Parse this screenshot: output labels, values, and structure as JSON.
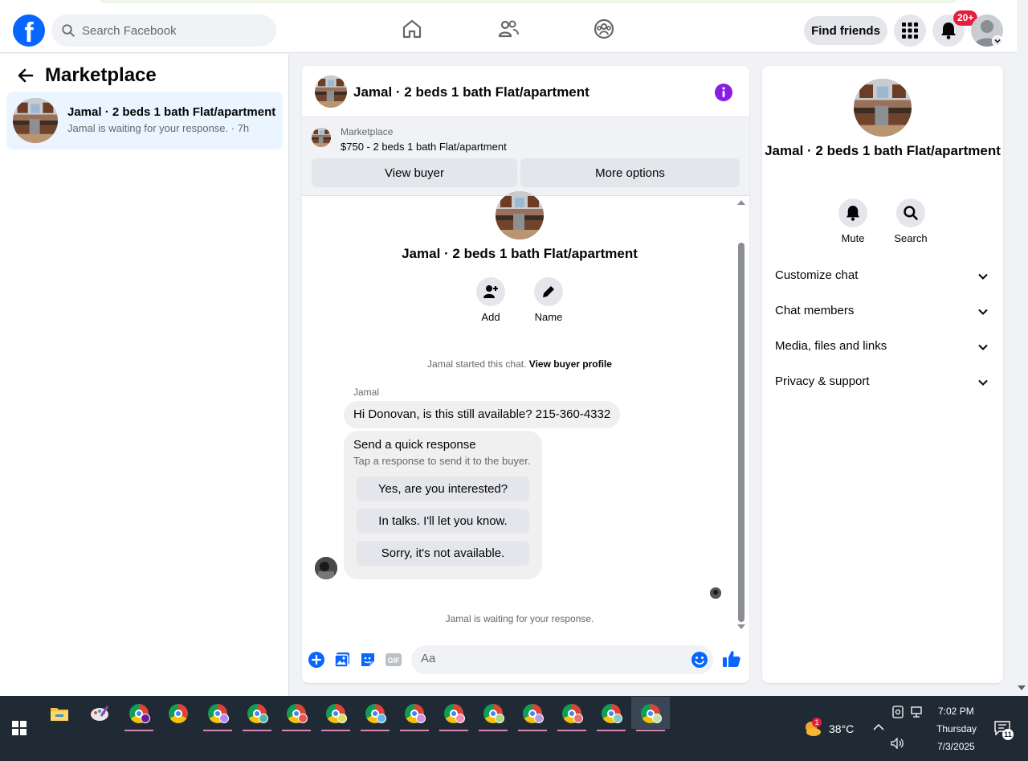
{
  "header": {
    "logo": "f",
    "search_placeholder": "Search Facebook",
    "find_friends_label": "Find friends",
    "notifications_badge": "20+"
  },
  "sidebar": {
    "title": "Marketplace",
    "conversation": {
      "title": "Jamal · 2 beds 1 bath Flat/apartment",
      "subtitle": "Jamal is waiting for your response. · 7h"
    }
  },
  "chat": {
    "header_title": "Jamal · 2 beds 1 bath Flat/apartment",
    "marketplace_label": "Marketplace",
    "listing": "$750 - 2 beds 1 bath Flat/apartment",
    "view_buyer_label": "View buyer",
    "more_options_label": "More options",
    "intro_title": "Jamal · 2 beds 1 bath Flat/apartment",
    "actions": [
      {
        "label": "Add",
        "icon": "add-person-icon"
      },
      {
        "label": "Name",
        "icon": "pencil-icon"
      }
    ],
    "started_text": "Jamal started this chat.",
    "view_profile_link": "View buyer profile",
    "sender": "Jamal",
    "message": "Hi Donovan, is this still available? 215-360-4332",
    "quick_response": {
      "title": "Send a quick response",
      "subtitle": "Tap a response to send it to the buyer.",
      "options": [
        "Yes, are you interested?",
        "In talks. I'll let you know.",
        "Sorry, it's not available."
      ]
    },
    "waiting_text": "Jamal is waiting for your response.",
    "composer_placeholder": "Aa"
  },
  "details": {
    "title": "Jamal · 2 beds 1 bath Flat/apartment",
    "actions": [
      {
        "label": "Mute",
        "icon": "bell-icon"
      },
      {
        "label": "Search",
        "icon": "search-icon"
      }
    ],
    "sections": [
      "Customize chat",
      "Chat members",
      "Media, files and links",
      "Privacy & support"
    ]
  },
  "taskbar": {
    "temperature": "38°C",
    "weather_badge": "1",
    "time": "7:02 PM",
    "day": "Thursday",
    "date": "7/3/2025",
    "notification_count": "11"
  },
  "colors": {
    "brand_blue": "#0866ff",
    "accent_purple": "#8a1ce6",
    "badge_red": "#e41e3f",
    "selected_bg": "#ebf5ff"
  }
}
